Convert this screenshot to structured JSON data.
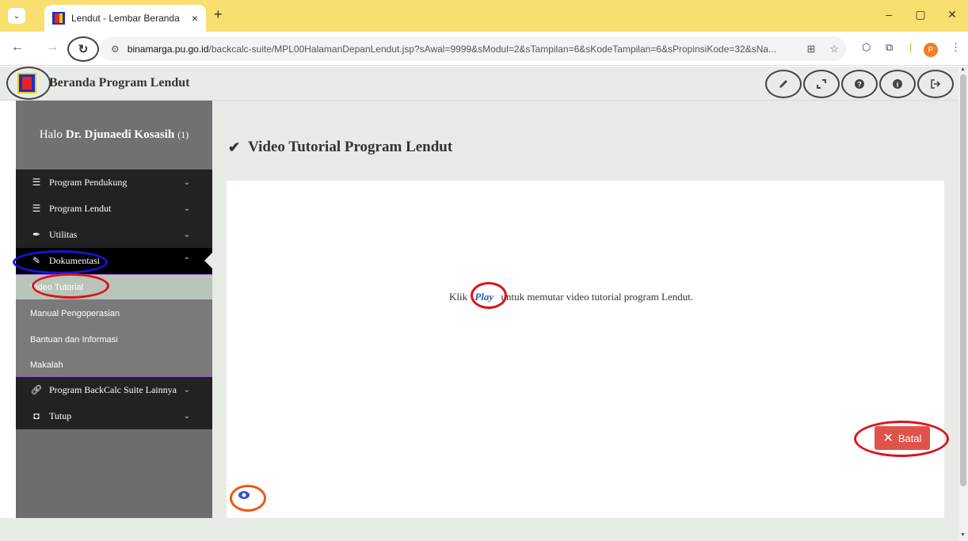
{
  "browser": {
    "tab_title": "Lendut - Lembar Beranda",
    "tab_close": "×",
    "new_tab": "+",
    "url_domain": "binamarga.pu.go.id",
    "url_path": "/backcalc-suite/MPL00HalamanDepanLendut.jsp?sAwal=9999&sModul=2&sTampilan=6&sKodeTampilan=6&sPropinsiKode=32&sNa...",
    "profile_initial": "P",
    "colors": {
      "tabstrip": "#f9df6f",
      "profile": "#f07e26"
    }
  },
  "header": {
    "title": "Beranda Program Lendut",
    "icons": [
      "pencil-icon",
      "expand-icon",
      "help-icon",
      "info-icon",
      "logout-icon"
    ]
  },
  "sidebar": {
    "greeting_prefix": "Halo",
    "user_name": "Dr. Djunaedi Kosasih",
    "user_count": "(1)",
    "menu": [
      {
        "label": "Program Pendukung",
        "icon": "list-icon"
      },
      {
        "label": "Program Lendut",
        "icon": "list-icon"
      },
      {
        "label": "Utilitas",
        "icon": "feather-icon"
      },
      {
        "label": "Dokumentasi",
        "icon": "pencil-icon"
      },
      {
        "label": "Program BackCalc Suite Lainnya",
        "icon": "link-icon"
      },
      {
        "label": "Tutup",
        "icon": "stop-icon"
      }
    ],
    "submenu": [
      {
        "label": "Video Tutorial"
      },
      {
        "label": "Manual Pengoperasian"
      },
      {
        "label": "Bantuan dan Informasi"
      },
      {
        "label": "Makalah"
      }
    ]
  },
  "main": {
    "title": "Video Tutorial Program Lendut",
    "instruction_prefix": "Klik",
    "play_label": "Play",
    "instruction_suffix": "untuk memutar video tutorial program Lendut.",
    "batal_label": "Batal",
    "colors": {
      "batal": "#e0534a",
      "play": "#2c5fb0"
    }
  }
}
